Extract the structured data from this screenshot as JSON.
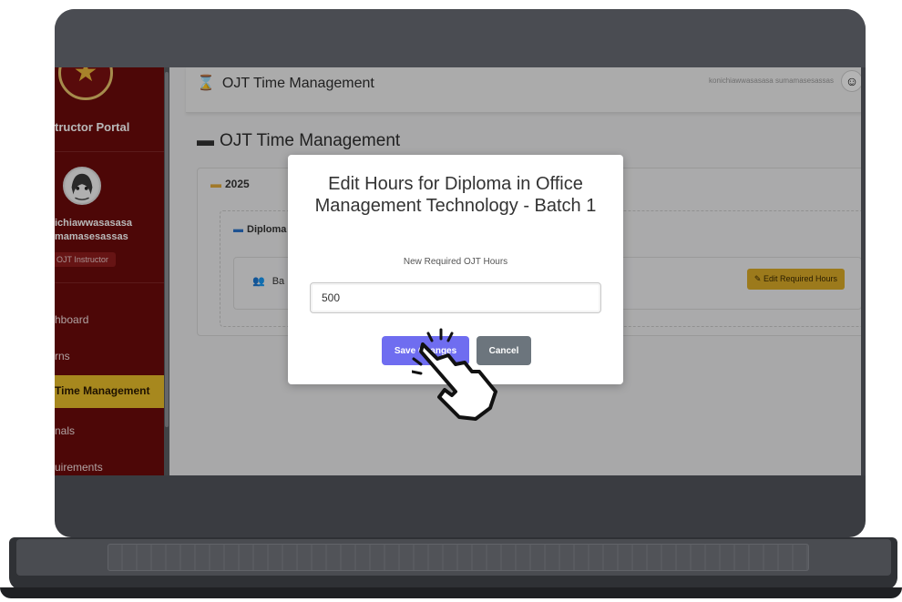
{
  "sidebar": {
    "portal_title": "tructor Portal",
    "user_name_line1": "ichiawwasasasa",
    "user_name_line2": "mamasesassas",
    "role": "OJT Instructor",
    "items": [
      {
        "label": "hboard"
      },
      {
        "label": "rns"
      },
      {
        "label": "Time Management",
        "active": true
      },
      {
        "label": "nals"
      },
      {
        "label": "uirements"
      }
    ]
  },
  "topbar": {
    "title": "OJT Time Management",
    "user": "konichiawwasasasa sumamasesassas"
  },
  "page": {
    "heading": "OJT Time Management",
    "year": "2025",
    "diploma": "Diploma",
    "batch": "Ba",
    "edit_button": "Edit Required Hours"
  },
  "modal": {
    "title": "Edit Hours for Diploma in Office Management Technology - Batch 1",
    "field_label": "New Required OJT Hours",
    "field_value": "500",
    "save_label": "Save Changes",
    "cancel_label": "Cancel"
  },
  "colors": {
    "sidebar": "#6b0b0b",
    "active_nav": "#e8bd2a",
    "save_button": "#6f6df0",
    "cancel_button": "#6c757d",
    "edit_button": "#d8a928"
  },
  "icons": [
    "hourglass-icon",
    "folder-open-icon",
    "users-icon",
    "edit-icon",
    "star-emblem-icon",
    "pointer-hand-icon"
  ]
}
